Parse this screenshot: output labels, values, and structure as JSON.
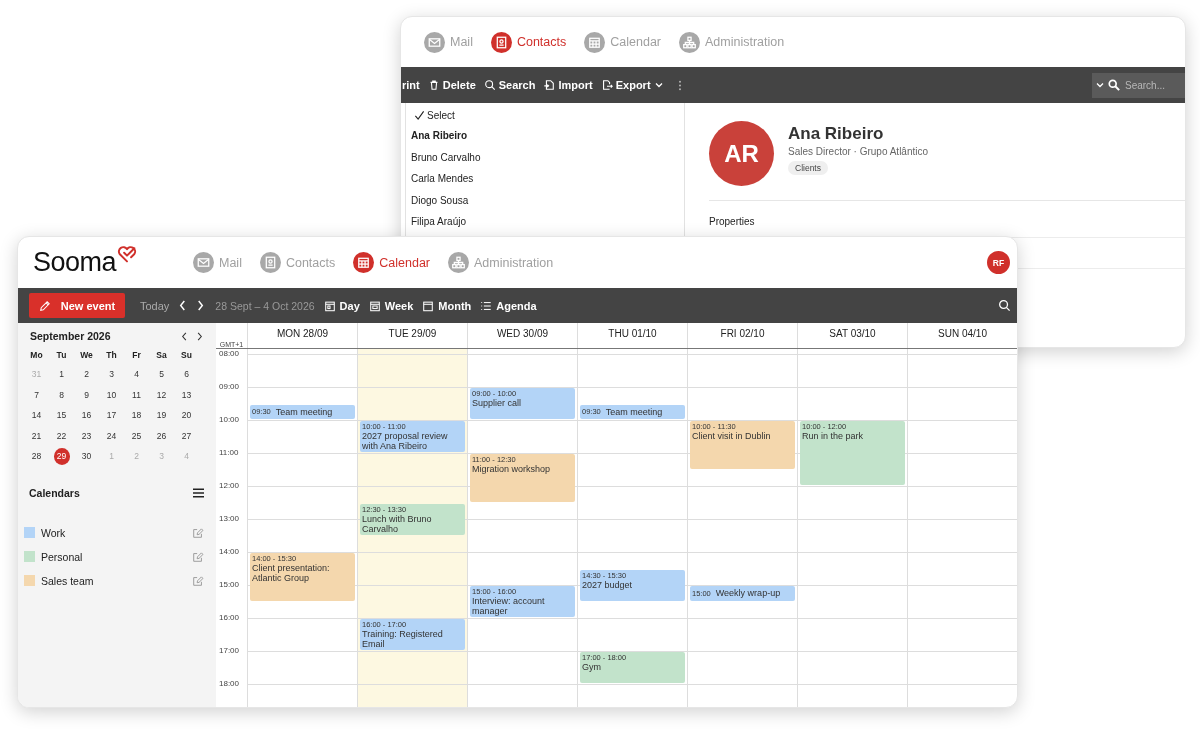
{
  "back_window": {
    "tabs": [
      {
        "label": "Mail",
        "selected": false
      },
      {
        "label": "Contacts",
        "selected": true
      },
      {
        "label": "Calendar",
        "selected": false
      },
      {
        "label": "Administration",
        "selected": false
      }
    ],
    "toolbar": [
      {
        "label": "rint"
      },
      {
        "label": "Delete"
      },
      {
        "label": "Search"
      },
      {
        "label": "Import"
      },
      {
        "label": "Export"
      }
    ],
    "search": {
      "placeholder": "Search..."
    },
    "list": {
      "select_label": "Select",
      "contacts": [
        {
          "name": "Ana Ribeiro",
          "selected": true
        },
        {
          "name": "Bruno Carvalho",
          "selected": false
        },
        {
          "name": "Carla Mendes",
          "selected": false
        },
        {
          "name": "Diogo Sousa",
          "selected": false
        },
        {
          "name": "Filipa Araújo",
          "selected": false
        }
      ]
    },
    "contact": {
      "initials": "AR",
      "name": "Ana Ribeiro",
      "subtitle": "Sales Director · Grupo Atlântico",
      "tag": "Clients",
      "section": "Properties"
    }
  },
  "front_window": {
    "logo": "Sooma",
    "tabs": [
      {
        "label": "Mail",
        "selected": false
      },
      {
        "label": "Contacts",
        "selected": false
      },
      {
        "label": "Calendar",
        "selected": true
      },
      {
        "label": "Administration",
        "selected": false
      }
    ],
    "avatar": "RF",
    "toolbar": {
      "new_event": "New event",
      "today": "Today",
      "range": "28 Sept – 4 Oct 2026",
      "views": [
        {
          "label": "Day"
        },
        {
          "label": "Week"
        },
        {
          "label": "Month"
        },
        {
          "label": "Agenda"
        }
      ]
    },
    "mini_calendar": {
      "title": "September 2026",
      "weekdays": [
        "Mo",
        "Tu",
        "We",
        "Th",
        "Fr",
        "Sa",
        "Su"
      ],
      "weeks": [
        [
          {
            "day": "31",
            "muted": true,
            "selected": false
          },
          {
            "day": "1",
            "muted": false,
            "selected": false
          },
          {
            "day": "2",
            "muted": false,
            "selected": false
          },
          {
            "day": "3",
            "muted": false,
            "selected": false
          },
          {
            "day": "4",
            "muted": false,
            "selected": false
          },
          {
            "day": "5",
            "muted": false,
            "selected": false
          },
          {
            "day": "6",
            "muted": false,
            "selected": false
          }
        ],
        [
          {
            "day": "7",
            "muted": false,
            "selected": false
          },
          {
            "day": "8",
            "muted": false,
            "selected": false
          },
          {
            "day": "9",
            "muted": false,
            "selected": false
          },
          {
            "day": "10",
            "muted": false,
            "selected": false
          },
          {
            "day": "11",
            "muted": false,
            "selected": false
          },
          {
            "day": "12",
            "muted": false,
            "selected": false
          },
          {
            "day": "13",
            "muted": false,
            "selected": false
          }
        ],
        [
          {
            "day": "14",
            "muted": false,
            "selected": false
          },
          {
            "day": "15",
            "muted": false,
            "selected": false
          },
          {
            "day": "16",
            "muted": false,
            "selected": false
          },
          {
            "day": "17",
            "muted": false,
            "selected": false
          },
          {
            "day": "18",
            "muted": false,
            "selected": false
          },
          {
            "day": "19",
            "muted": false,
            "selected": false
          },
          {
            "day": "20",
            "muted": false,
            "selected": false
          }
        ],
        [
          {
            "day": "21",
            "muted": false,
            "selected": false
          },
          {
            "day": "22",
            "muted": false,
            "selected": false
          },
          {
            "day": "23",
            "muted": false,
            "selected": false
          },
          {
            "day": "24",
            "muted": false,
            "selected": false
          },
          {
            "day": "25",
            "muted": false,
            "selected": false
          },
          {
            "day": "26",
            "muted": false,
            "selected": false
          },
          {
            "day": "27",
            "muted": false,
            "selected": false
          }
        ],
        [
          {
            "day": "28",
            "muted": false,
            "selected": false
          },
          {
            "day": "29",
            "muted": false,
            "selected": true
          },
          {
            "day": "30",
            "muted": false,
            "selected": false
          },
          {
            "day": "1",
            "muted": true,
            "selected": false
          },
          {
            "day": "2",
            "muted": true,
            "selected": false
          },
          {
            "day": "3",
            "muted": true,
            "selected": false
          },
          {
            "day": "4",
            "muted": true,
            "selected": false
          }
        ]
      ]
    },
    "calendars": {
      "title": "Calendars",
      "items": [
        {
          "name": "Work",
          "color": "#b3d4f7"
        },
        {
          "name": "Personal",
          "color": "#c2e3cb"
        },
        {
          "name": "Sales team",
          "color": "#f4d7ad"
        }
      ]
    },
    "week": {
      "timezone": "GMT+1",
      "hours": [
        "08:00",
        "09:00",
        "10:00",
        "11:00",
        "12:00",
        "13:00",
        "14:00",
        "15:00",
        "16:00",
        "17:00",
        "18:00"
      ],
      "days": [
        {
          "label": "MON 28/09",
          "selected": false,
          "events": [
            {
              "kind": "compact",
              "time": "09:30",
              "title": "Team meeting",
              "color": "#b3d4f7"
            },
            {
              "kind": "block",
              "time": "14:00 - 15:30",
              "title": "Client presentation: Atlantic Group",
              "color": "#f4d7ad"
            }
          ]
        },
        {
          "label": "TUE 29/09",
          "selected": true,
          "events": [
            {
              "kind": "block",
              "time": "10:00 - 11:00",
              "title": "2027 proposal review with Ana Ribeiro",
              "color": "#b3d4f7"
            },
            {
              "kind": "block",
              "time": "12:30 - 13:30",
              "title": "Lunch with Bruno Carvalho",
              "color": "#c2e3cb"
            },
            {
              "kind": "block",
              "time": "16:00 - 17:00",
              "title": "Training: Registered Email",
              "color": "#b3d4f7"
            }
          ]
        },
        {
          "label": "WED 30/09",
          "selected": false,
          "events": [
            {
              "kind": "block",
              "time": "09:00 - 10:00",
              "title": "Supplier call",
              "color": "#b3d4f7"
            },
            {
              "kind": "block",
              "time": "11:00 - 12:30",
              "title": "Migration workshop",
              "color": "#f4d7ad"
            },
            {
              "kind": "block",
              "time": "15:00 - 16:00",
              "title": "Interview: account manager",
              "color": "#b3d4f7"
            }
          ]
        },
        {
          "label": "THU 01/10",
          "selected": false,
          "events": [
            {
              "kind": "compact",
              "time": "09:30",
              "title": "Team meeting",
              "color": "#b3d4f7"
            },
            {
              "kind": "block",
              "time": "14:30 - 15:30",
              "title": "2027 budget",
              "color": "#b3d4f7"
            },
            {
              "kind": "block",
              "time": "17:00 - 18:00",
              "title": "Gym",
              "color": "#c2e3cb"
            }
          ]
        },
        {
          "label": "FRI 02/10",
          "selected": false,
          "events": [
            {
              "kind": "block",
              "time": "10:00 - 11:30",
              "title": "Client visit in Dublin",
              "color": "#f4d7ad"
            },
            {
              "kind": "compact",
              "time": "15:00",
              "title": "Weekly wrap-up",
              "color": "#b3d4f7"
            }
          ]
        },
        {
          "label": "SAT 03/10",
          "selected": false,
          "events": [
            {
              "kind": "block",
              "time": "10:00 - 12:00",
              "title": "Run in the park",
              "color": "#c2e3cb"
            }
          ]
        },
        {
          "label": "SUN 04/10",
          "selected": false
        }
      ]
    }
  }
}
